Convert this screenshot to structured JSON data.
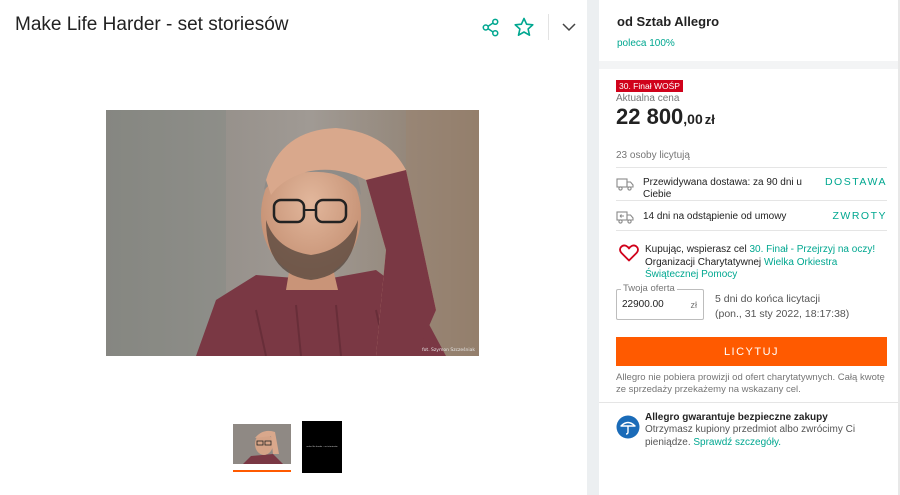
{
  "listing": {
    "title": "Make Life Harder - set storiesów",
    "photo_credit": "fot. Szymon Szcześniak",
    "thumb2_text": "make life harder - set storiesów"
  },
  "seller": {
    "name": "od Sztab Allegro",
    "rating": "poleca 100%"
  },
  "auction": {
    "badge": "30. Finał WOŚP",
    "price_label": "Aktualna cena",
    "price_main": "22 800",
    "price_decimals": ",00",
    "currency": "zł",
    "bidders": "23 osoby licytują"
  },
  "delivery": {
    "text": "Przewidywana dostawa: za 90 dni u Ciebie",
    "link": "DOSTAWA"
  },
  "returns": {
    "text": "14 dni na odstąpienie od umowy",
    "link": "ZWROTY"
  },
  "charity": {
    "text_before": "Kupując, wspierasz cel ",
    "goal_link": "30. Finał - Przejrzyj na oczy!",
    "text_middle": " Organizacji Charytatywnej ",
    "org_link": "Wielka Orkiestra Świątecznej Pomocy"
  },
  "offer": {
    "label": "Twoja oferta",
    "value": "22900.00",
    "currency": "zł",
    "ends_in": "5 dni do końca licytacji",
    "ends_date": "(pon., 31 sty 2022, 18:17:38)"
  },
  "bid_button": "LICYTUJ",
  "fee_note": "Allegro nie pobiera prowizji od ofert charytatywnych. Całą kwotę ze sprzedaży przekażemy na wskazany cel.",
  "guarantee": {
    "title": "Allegro gwarantuje bezpieczne zakupy",
    "text": "Otrzymasz kupiony przedmiot albo zwrócimy Ci pieniądze. ",
    "link": "Sprawdź szczegóły."
  },
  "colors": {
    "accent_orange": "#ff5a00",
    "teal": "#00a790",
    "badge_red": "#d0021b"
  },
  "icons": [
    "share-icon",
    "star-icon",
    "chevron-down-icon",
    "truck-icon",
    "return-truck-icon",
    "heart-icon",
    "shield-icon"
  ]
}
